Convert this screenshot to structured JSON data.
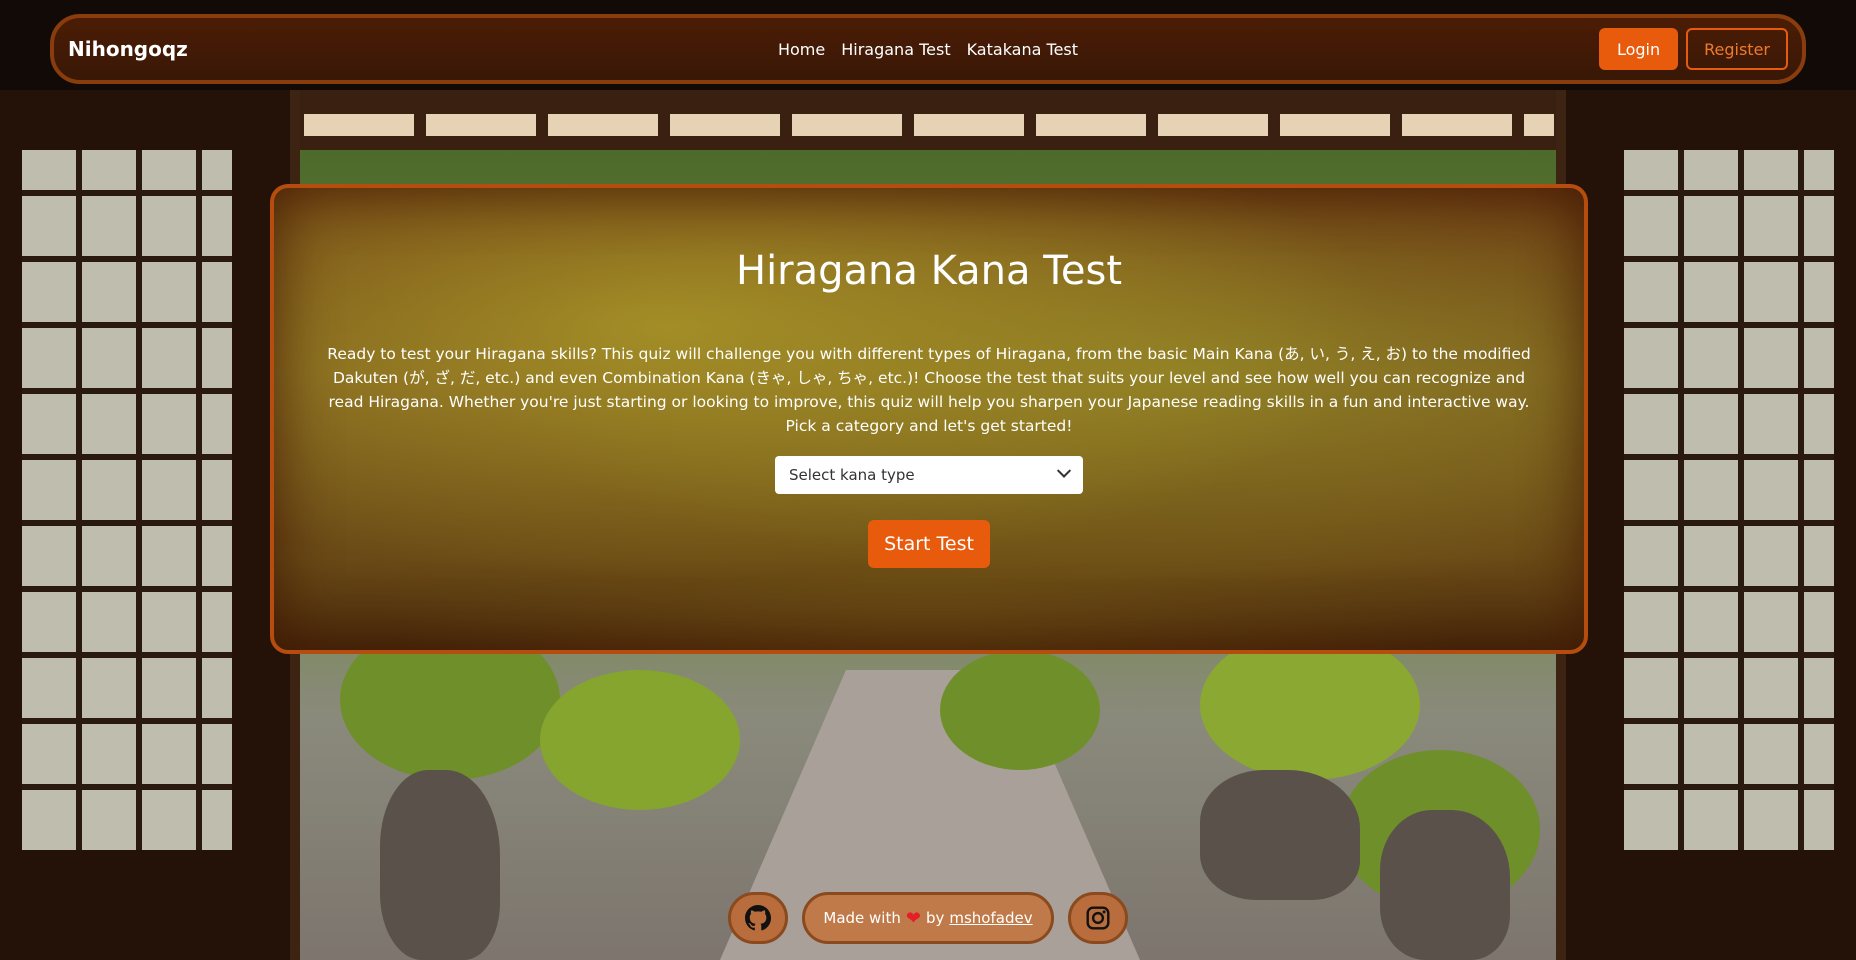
{
  "nav": {
    "brand": "Nihongoqz",
    "links": [
      "Home",
      "Hiragana Test",
      "Katakana Test"
    ],
    "login_label": "Login",
    "register_label": "Register"
  },
  "hero": {
    "title": "Hiragana Kana Test",
    "description": "Ready to test your Hiragana skills? This quiz will challenge you with different types of Hiragana, from the basic Main Kana (あ, い, う, え, お) to the modified Dakuten (が, ざ, だ, etc.) and even Combination Kana (きゃ, しゃ, ちゃ, etc.)! Choose the test that suits your level and see how well you can recognize and read Hiragana. Whether you're just starting or looking to improve, this quiz will help you sharpen your Japanese reading skills in a fun and interactive way. Pick a category and let's get started!",
    "select_placeholder": "Select kana type",
    "start_label": "Start Test"
  },
  "footer": {
    "made_with": "Made with",
    "by": "by",
    "author": "mshofadev",
    "left_icon": "github-icon",
    "right_icon": "instagram-icon"
  },
  "colors": {
    "accent": "#e85a0c",
    "card_border": "#b44d0d",
    "heart": "#e3202a"
  }
}
